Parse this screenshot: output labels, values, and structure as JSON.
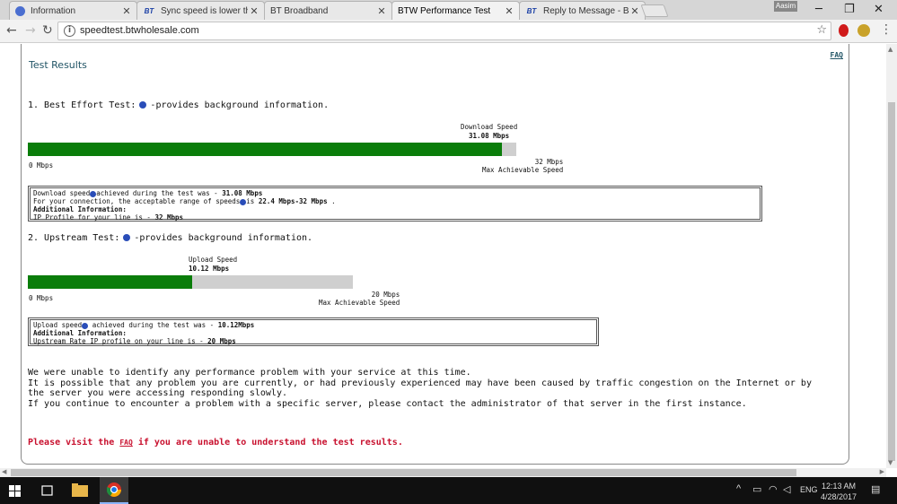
{
  "browser": {
    "tabs": [
      {
        "label": "Information",
        "icon": "globe-icon"
      },
      {
        "label": "Sync speed is lower than",
        "icon": "bt-icon"
      },
      {
        "label": "BT Broadband",
        "icon": "page-icon"
      },
      {
        "label": "BTW Performance Test",
        "icon": "page-icon",
        "active": true
      },
      {
        "label": "Reply to Message - BTCa",
        "icon": "bt-icon"
      }
    ],
    "profile_name": "Aasim",
    "url": "speedtest.btwholesale.com",
    "bt_icon_text": "BT"
  },
  "page": {
    "title": "Test Results",
    "faq_link": "FAQ",
    "best_effort": {
      "heading_prefix": "1. Best Effort Test:",
      "heading_suffix": "-provides background information.",
      "speed_label": "Download Speed",
      "speed_value": "31.08 Mbps",
      "min_label": "0 Mbps",
      "max_value": "32 Mbps",
      "max_label": "Max Achievable Speed",
      "fill_fraction": 0.9713,
      "info_lines": [
        {
          "pre": "Download speed",
          "q": true,
          "mid": "achieved during the test was - ",
          "bold": "31.08 Mbps"
        },
        {
          "pre": "For your connection, the acceptable range of speeds",
          "q": true,
          "mid": "is ",
          "bold": "22.4 Mbps-32 Mbps",
          "post": " ."
        },
        {
          "bold": "Additional Information:"
        },
        {
          "pre": "IP Profile for your line is - ",
          "bold": "32 Mbps"
        }
      ]
    },
    "upstream": {
      "heading_prefix": "2. Upstream Test:",
      "heading_suffix": "-provides background information.",
      "speed_label": "Upload Speed",
      "speed_value": "10.12 Mbps",
      "min_label": "0 Mbps",
      "max_value": "20 Mbps",
      "max_label": "Max Achievable Speed",
      "fill_fraction": 0.506,
      "info_lines": [
        {
          "pre": "Upload speed",
          "q": true,
          "mid": " achieved during the test was - ",
          "bold": "10.12Mbps"
        },
        {
          "bold": "Additional Information:"
        },
        {
          "pre": "Upstream Rate IP profile on your line is - ",
          "bold": "20 Mbps"
        }
      ]
    },
    "message_lines": [
      "We were unable to identify any performance problem with your service at this time.",
      "It is possible that any problem you are currently, or had previously experienced may have been caused by traffic congestion on the Internet or by the server you were accessing responding slowly.",
      "If you continue to encounter a problem with a specific server, please contact the administrator of that server in the first instance."
    ],
    "warning_prefix": "Please visit the ",
    "warning_link": "FAQ",
    "warning_suffix": " if you are unable to understand the test results."
  },
  "taskbar": {
    "language": "ENG",
    "time": "12:13 AM",
    "date": "4/28/2017"
  },
  "colors": {
    "bar_fill": "#0a7d0a",
    "bar_bg": "#cfcfcf",
    "warning": "#c8102e",
    "heading": "#225566"
  }
}
